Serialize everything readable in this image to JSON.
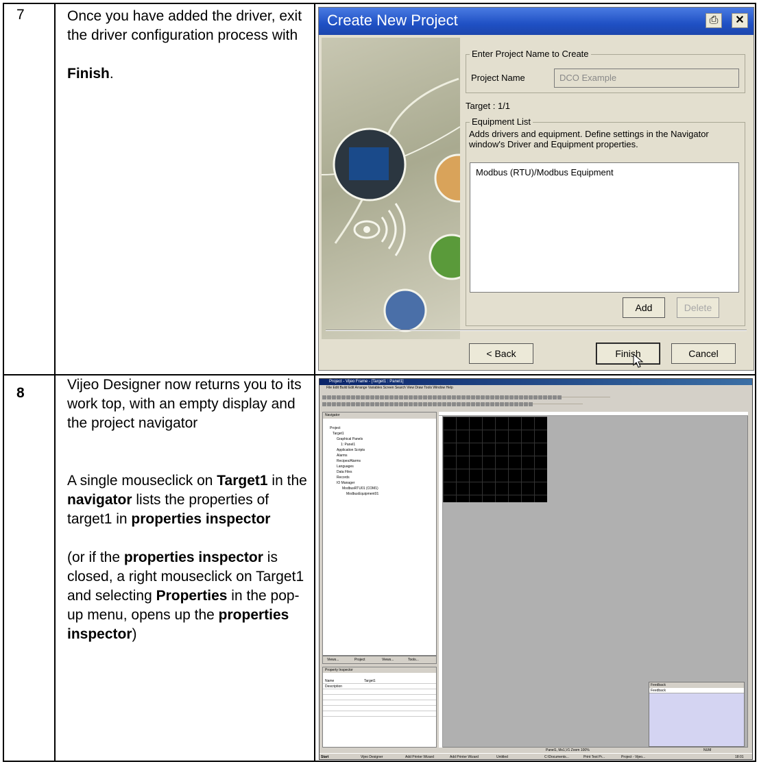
{
  "rows": [
    {
      "number": "7",
      "instruction": {
        "text": "Once you have added the driver, exit the driver configuration process with",
        "emphasis": "Finish",
        "trailing": "."
      },
      "dialog": {
        "title": "Create New Project",
        "print_icon": "printer-icon",
        "close_icon": "close-icon",
        "project_group": {
          "label": "Enter Project Name to Create",
          "field_label": "Project Name",
          "field_value": "DCO Example"
        },
        "target_label": "Target : 1/1",
        "equipment_group": {
          "label": "Equipment List",
          "description": "Adds drivers and equipment. Define settings in the Navigator window's Driver and Equipment properties.",
          "items": [
            "Modbus (RTU)/Modbus Equipment"
          ],
          "add_label": "Add",
          "delete_label": "Delete"
        },
        "back_label": "< Back",
        "finish_label": "Finish",
        "cancel_label": "Cancel"
      }
    },
    {
      "number": "8",
      "instruction": {
        "p1": "Vijeo Designer now returns you to its work top, with an empty display and the project navigator",
        "p2": [
          {
            "t": "A single mouseclick on ",
            "b": false
          },
          {
            "t": "Target1",
            "b": true
          },
          {
            "t": " in the ",
            "b": false
          },
          {
            "t": "navigator",
            "b": true
          },
          {
            "t": " lists the properties of target1 in ",
            "b": false
          },
          {
            "t": "properties inspector",
            "b": true
          }
        ],
        "p3": [
          {
            "t": "(or if the ",
            "b": false
          },
          {
            "t": "properties inspector",
            "b": true
          },
          {
            "t": " is closed, a right mouseclick on Target1 and selecting ",
            "b": false
          },
          {
            "t": "Properties",
            "b": true
          },
          {
            "t": " in the pop-up menu, opens up the ",
            "b": false
          },
          {
            "t": "properties inspector",
            "b": true
          },
          {
            "t": ")",
            "b": false
          }
        ]
      },
      "screenshot": {
        "title": "Project - Vijeo Frame - [Target1 : Panel1]",
        "menu": "File  Edit  Build  Edit  Arrange  Variables  Screen  Search  View  Draw  Tools  Window  Help",
        "navigator_title": "Navigator",
        "navigator_items": [
          "Project",
          "Target1",
          "Graphical Panels",
          "1: Panel1",
          "Application Scripts",
          "Alarms",
          "Recipes/Alarms",
          "Languages",
          "Data Files",
          "Records",
          "IO Manager",
          "ModbusRTU01 (COM1)",
          "ModbusEquipment01"
        ],
        "navigator_tabs": [
          "Views...",
          "Project",
          "Views...",
          "Tools..."
        ],
        "property_inspector_title": "Property Inspector",
        "property_rows": [
          {
            "key": "Name",
            "value": "Target1"
          },
          {
            "key": "Description",
            "value": ""
          }
        ],
        "feedback_title": "Feedback",
        "feedback_tab": "Feedback",
        "status_text": "Panel1, Mx1,V1    Zoom 100%",
        "status_right": "NUM",
        "taskbar_items": [
          "Start",
          "Vijeo Designer",
          "Add Printer Wizard",
          "Add Printer Wizard",
          "Untitled",
          "C:\\Documents...",
          "Print Test Pr...",
          "Project - Vijeo..."
        ],
        "clock": "18:01"
      }
    }
  ]
}
